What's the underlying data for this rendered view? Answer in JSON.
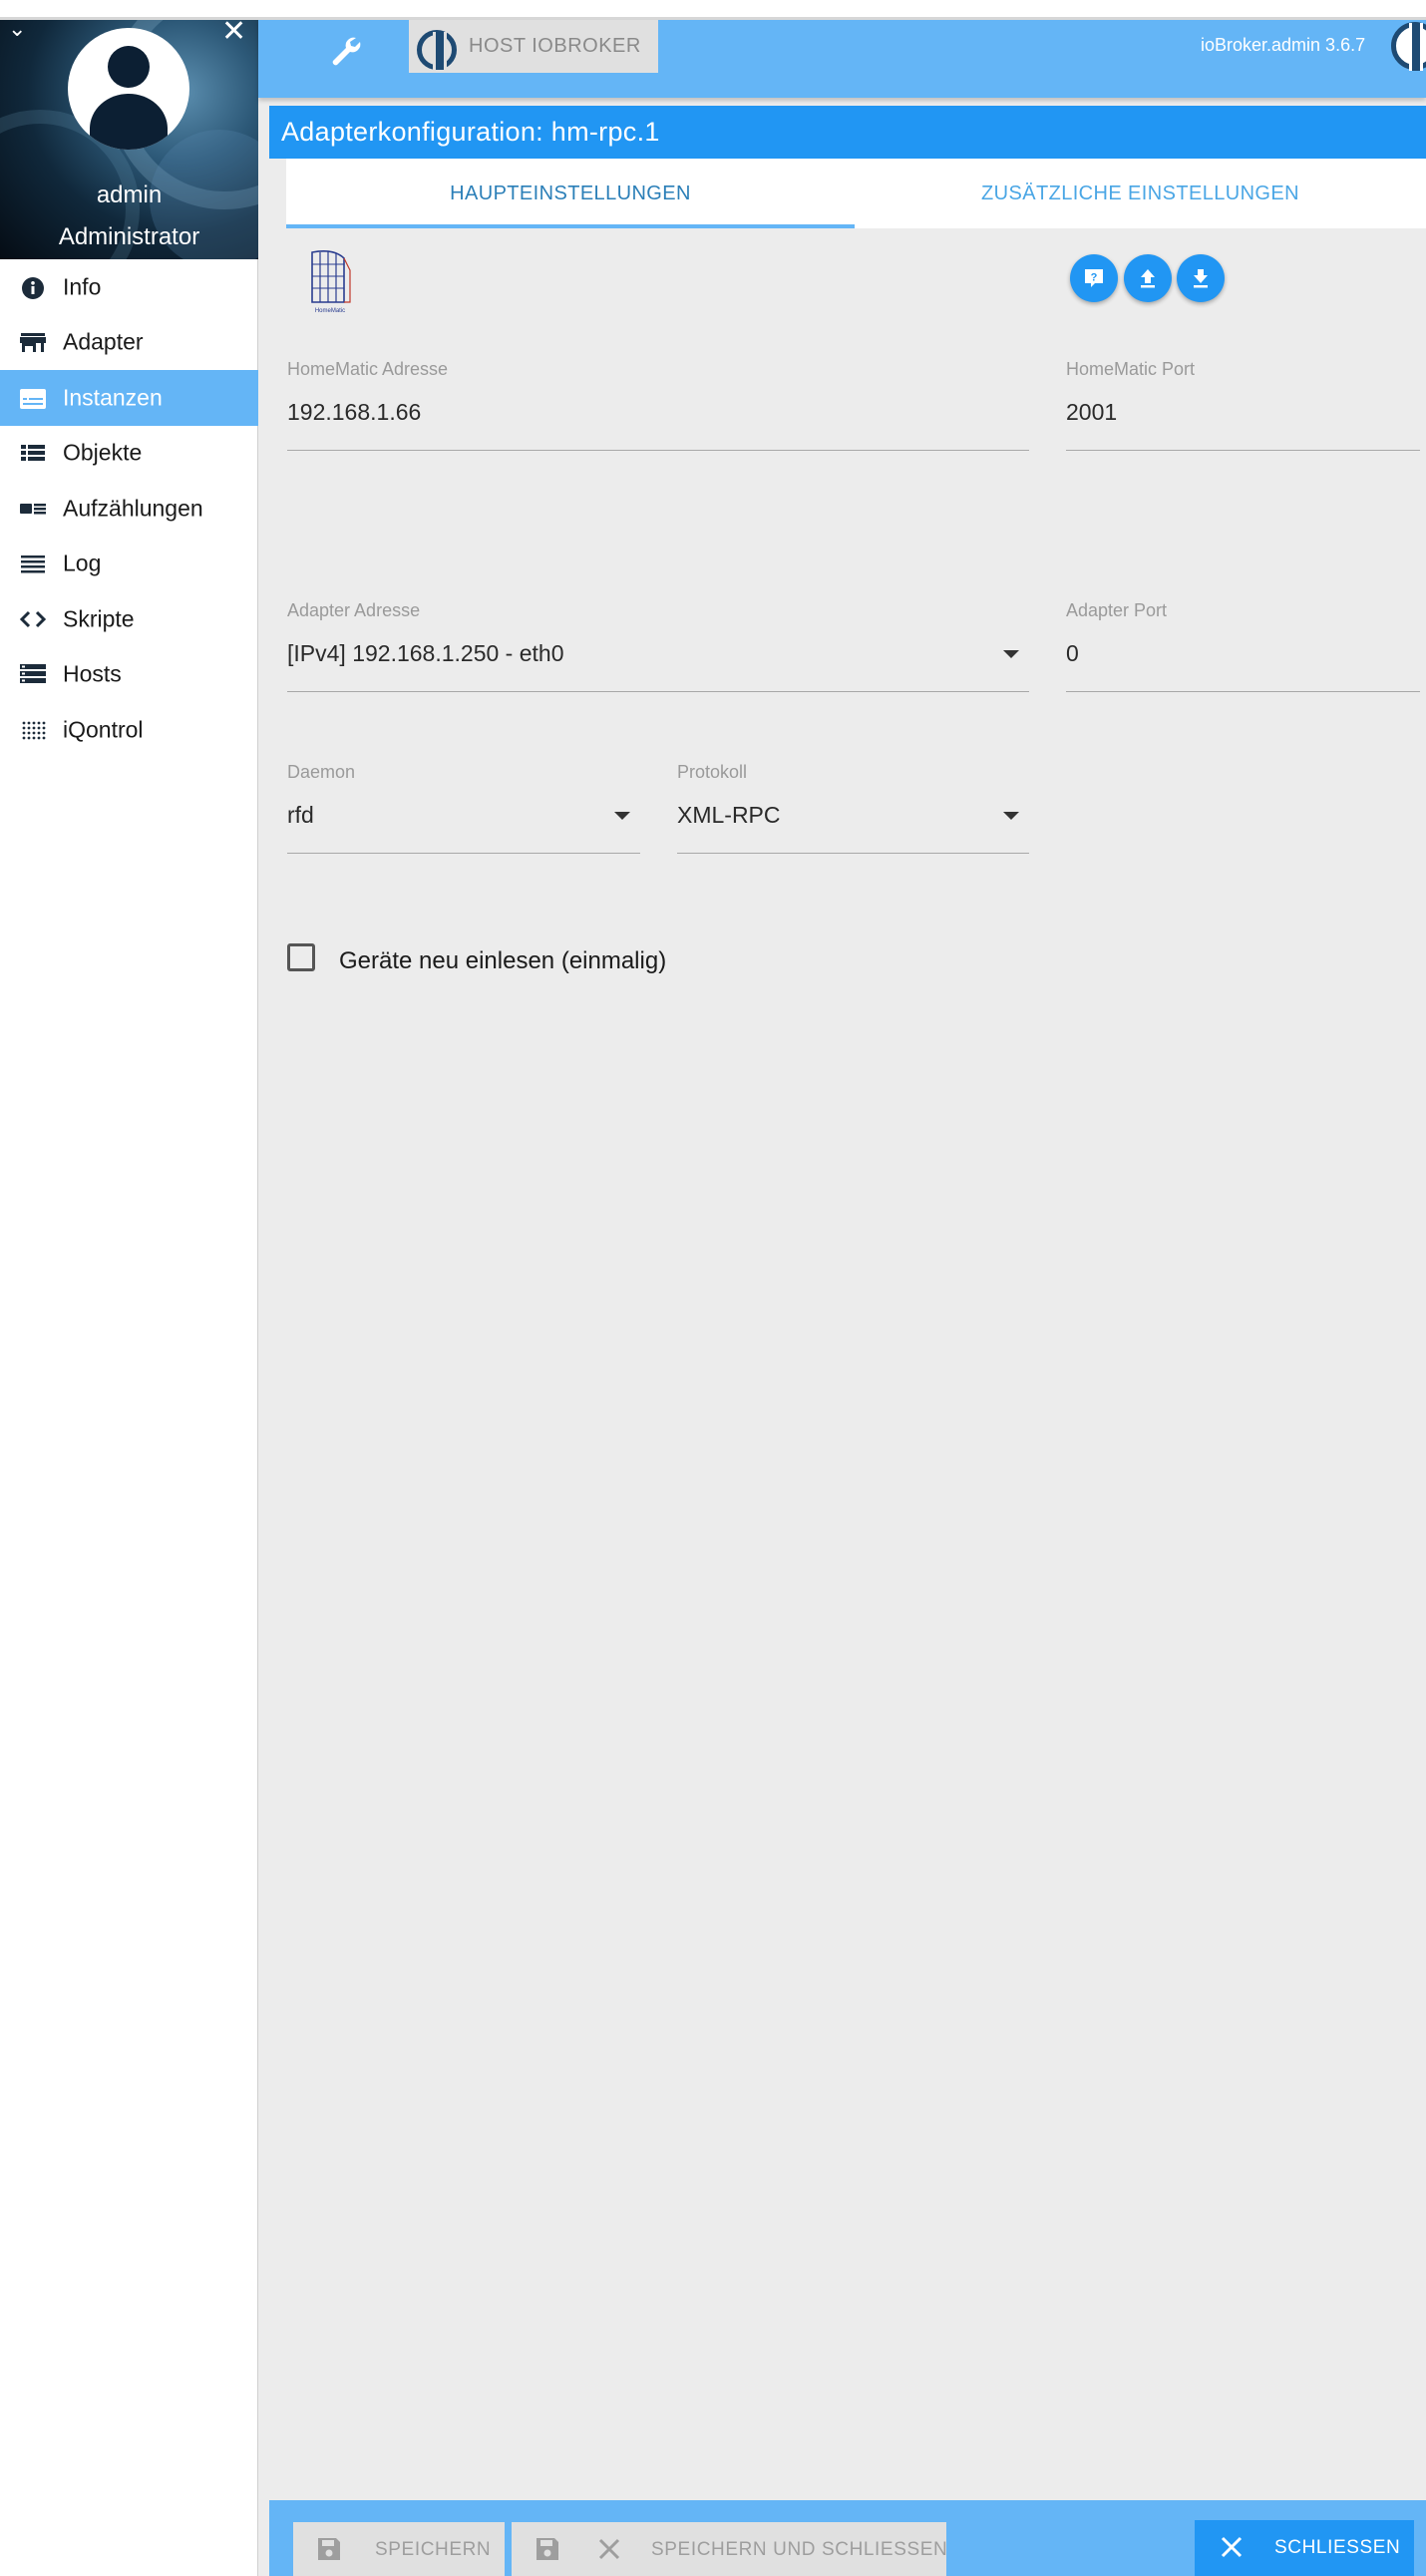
{
  "sidebar": {
    "username": "admin",
    "role": "Administrator",
    "items": [
      {
        "label": "Info",
        "icon": "info-icon"
      },
      {
        "label": "Adapter",
        "icon": "store-icon"
      },
      {
        "label": "Instanzen",
        "icon": "instances-icon",
        "active": true
      },
      {
        "label": "Objekte",
        "icon": "list-icon"
      },
      {
        "label": "Aufzählungen",
        "icon": "enum-icon"
      },
      {
        "label": "Log",
        "icon": "log-icon"
      },
      {
        "label": "Skripte",
        "icon": "code-icon"
      },
      {
        "label": "Hosts",
        "icon": "hosts-icon"
      },
      {
        "label": "iQontrol",
        "icon": "dots-grid-icon"
      }
    ]
  },
  "appbar": {
    "host_label": "HOST IOBROKER",
    "version": "ioBroker.admin 3.6.7"
  },
  "config": {
    "title": "Adapterkonfiguration: hm-rpc.1",
    "tabs": [
      {
        "label": "HAUPTEINSTELLUNGEN",
        "active": true
      },
      {
        "label": "ZUSÄTZLICHE EINSTELLUNGEN",
        "active": false
      }
    ],
    "logo_text": "HomeMatic",
    "fields": {
      "homematic_address": {
        "label": "HomeMatic Adresse",
        "value": "192.168.1.66"
      },
      "homematic_port": {
        "label": "HomeMatic Port",
        "value": "2001"
      },
      "adapter_address": {
        "label": "Adapter Adresse",
        "value": "[IPv4] 192.168.1.250 - eth0"
      },
      "adapter_port": {
        "label": "Adapter Port",
        "value": "0"
      },
      "daemon": {
        "label": "Daemon",
        "value": "rfd"
      },
      "protocol": {
        "label": "Protokoll",
        "value": "XML-RPC"
      }
    },
    "checkbox": {
      "label": "Geräte neu einlesen (einmalig)",
      "checked": false
    }
  },
  "bottombar": {
    "save_label": "SPEICHERN",
    "save_close_label": "SPEICHERN UND SCHLIESSEN",
    "close_label": "SCHLIESSEN"
  },
  "colors": {
    "primary": "#2196f3",
    "primary_light": "#64b5f6",
    "sidebar_active": "#64b5f6"
  }
}
